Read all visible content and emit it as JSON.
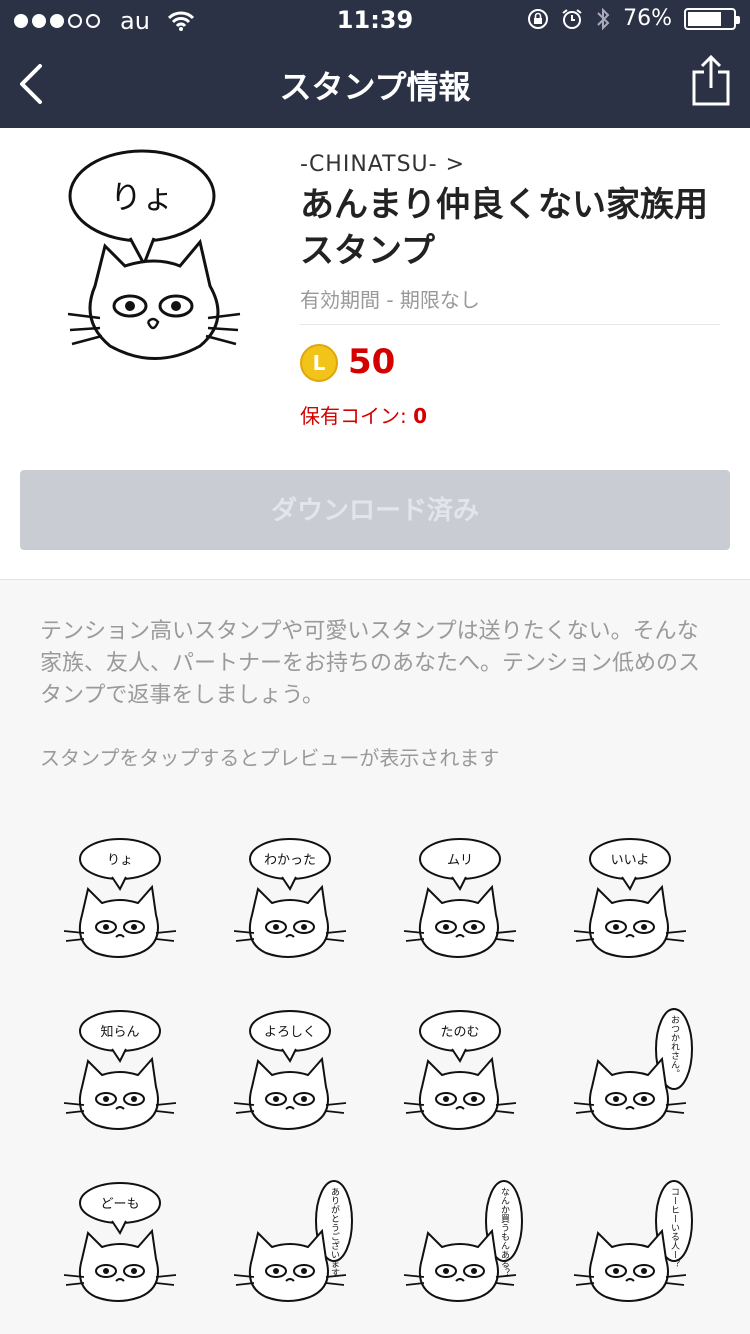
{
  "status": {
    "carrier": "au",
    "time": "11:39",
    "battery_label": "76%",
    "battery_level": 0.76,
    "signal_dots": 5,
    "signal_on": 3
  },
  "nav": {
    "title": "スタンプ情報"
  },
  "sticker": {
    "main_bubble_text": "りょ",
    "author": "-CHINATSU-",
    "author_chevron": ">",
    "title": "あんまり仲良くない家族用スタンプ",
    "validity": "有効期間 - 期限なし",
    "coin_letter": "L",
    "price": "50",
    "owned_label": "保有コイン: ",
    "owned_value": "0",
    "download_label": "ダウンロード済み"
  },
  "description": "テンション高いスタンプや可愛いスタンプは送りたくない。そんな家族、友人、パートナーをお持ちのあなたへ。テンション低めのスタンプで返事をしましょう。",
  "preview_hint": "スタンプをタップするとプレビューが表示されます",
  "stickers": [
    {
      "text": "りょ"
    },
    {
      "text": "わかった"
    },
    {
      "text": "ムリ"
    },
    {
      "text": "いいよ"
    },
    {
      "text": "知らん"
    },
    {
      "text": "よろしく"
    },
    {
      "text": "たのむ"
    },
    {
      "text": "おつかれさん。"
    },
    {
      "text": "どーも"
    },
    {
      "text": "ありがとうございます"
    },
    {
      "text": "なんか買うもんある？"
    },
    {
      "text": "コーヒーいる人ー？"
    }
  ],
  "colors": {
    "nav_bg": "#2b3245",
    "price": "#d40000",
    "coin": "#f2c318",
    "button_disabled": "#c9ccd3"
  }
}
